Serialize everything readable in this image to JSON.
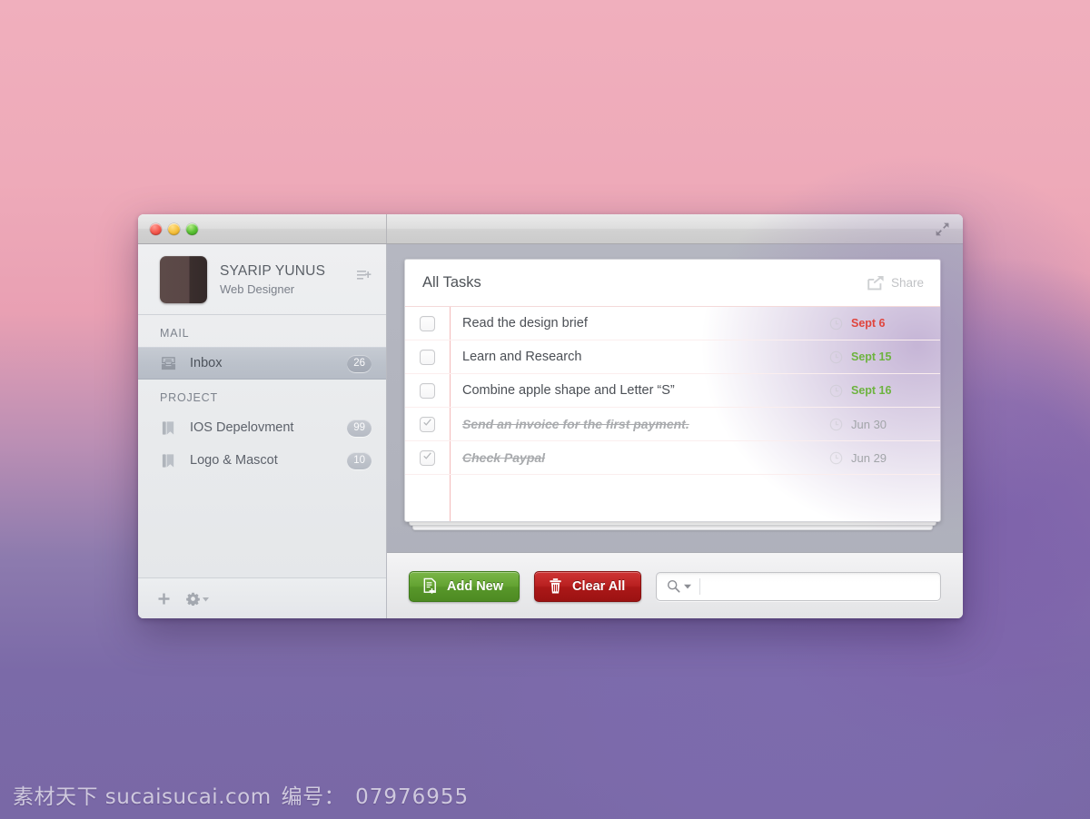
{
  "window": {
    "traffic_lights": [
      "close",
      "minimize",
      "zoom"
    ],
    "expand_icon": "fullscreen-arrows-icon"
  },
  "sidebar": {
    "profile": {
      "name": "SYARIP YUNUS",
      "role": "Web Designer",
      "avatar": "user-avatar",
      "action_icon": "add-to-list-icon"
    },
    "groups": [
      {
        "label": "MAIL",
        "items": [
          {
            "label": "Inbox",
            "badge": "26",
            "icon": "inbox-tray-icon",
            "selected": true
          }
        ]
      },
      {
        "label": "PROJECT",
        "items": [
          {
            "label": "IOS Depelovment",
            "badge": "99",
            "icon": "book-icon",
            "selected": false
          },
          {
            "label": "Logo & Mascot",
            "badge": "10",
            "icon": "book-icon",
            "selected": false
          }
        ]
      }
    ],
    "footer": {
      "add_icon": "plus-icon",
      "settings_icon": "gear-icon",
      "settings_caret": "caret-down-icon"
    }
  },
  "main": {
    "card_title": "All Tasks",
    "share_label": "Share",
    "share_icon": "share-box-arrow-icon",
    "tasks": [
      {
        "label": "Read the design brief",
        "done": false,
        "date": "Sept 6",
        "date_state": "overdue",
        "clock_icon": "clock-icon"
      },
      {
        "label": "Learn and Research",
        "done": false,
        "date": "Sept 15",
        "date_state": "upcoming",
        "clock_icon": "clock-icon"
      },
      {
        "label": "Combine apple shape and Letter “S”",
        "done": false,
        "date": "Sept 16",
        "date_state": "upcoming",
        "clock_icon": "clock-icon"
      },
      {
        "label": "Send an invoice for the first payment.",
        "done": true,
        "date": "Jun 30",
        "date_state": "past",
        "clock_icon": "clock-icon"
      },
      {
        "label": "Check Paypal",
        "done": true,
        "date": "Jun 29",
        "date_state": "past",
        "clock_icon": "clock-icon"
      }
    ]
  },
  "toolbar": {
    "add_new_label": "Add New",
    "add_new_icon": "document-plus-icon",
    "clear_all_label": "Clear All",
    "clear_all_icon": "trash-icon",
    "search_icon": "magnifier-icon",
    "search_caret": "caret-down-icon",
    "search_value": "",
    "search_placeholder": ""
  },
  "watermark": {
    "site": "素材天下 sucaisucai.com",
    "label": "编号：",
    "number": "07976955"
  },
  "colors": {
    "accent_green": "#63a332",
    "accent_red": "#b82020",
    "date_overdue": "#e0443c",
    "date_upcoming": "#6db33f",
    "date_past": "#a2a5a9",
    "desktop_pink": "#eeaab9",
    "desktop_purple": "#7b6aa8"
  }
}
